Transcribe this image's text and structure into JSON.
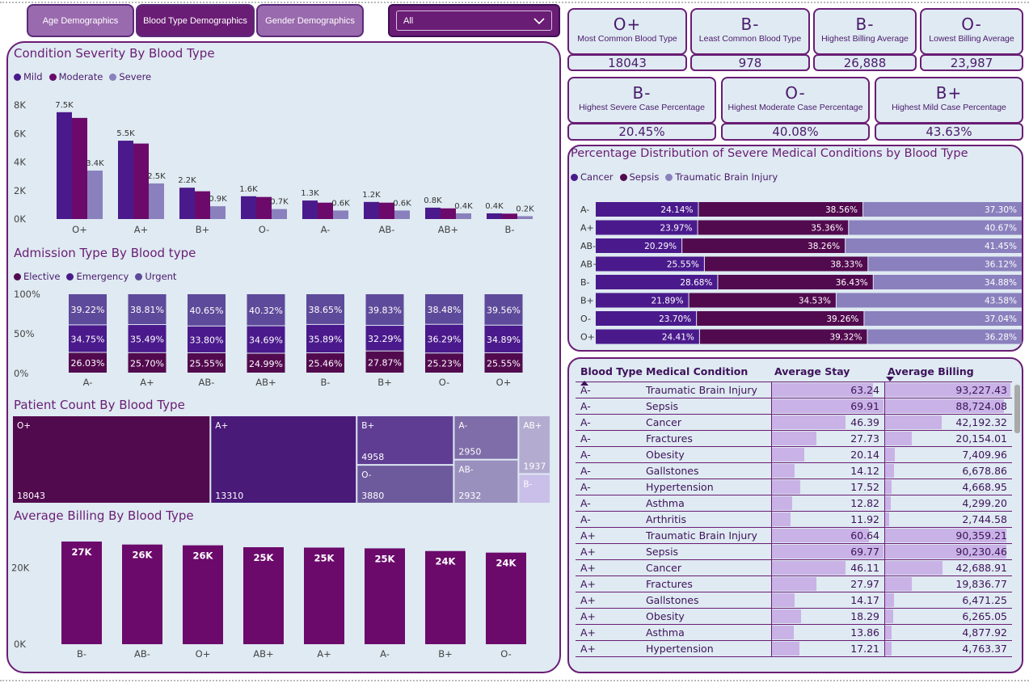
{
  "nav": {
    "tabs": [
      {
        "label": "Age Demographics",
        "active": false
      },
      {
        "label": "Blood Type Demographics",
        "active": true
      },
      {
        "label": "Gender Demographics",
        "active": false
      }
    ],
    "filter_value": "All"
  },
  "kpis": {
    "row1": [
      {
        "value": "O+",
        "label": "Most Common Blood Type",
        "metric": "18043"
      },
      {
        "value": "B-",
        "label": "Least Common Blood Type",
        "metric": "978"
      },
      {
        "value": "B-",
        "label": "Highest Billing Average",
        "metric": "26,888"
      },
      {
        "value": "O-",
        "label": "Lowest Billing Average",
        "metric": "23,987"
      }
    ],
    "row2": [
      {
        "value": "B-",
        "label": "Highest Severe Case Percentage",
        "metric": "20.45%"
      },
      {
        "value": "O-",
        "label": "Highest Moderate Case Percentage",
        "metric": "40.08%"
      },
      {
        "value": "B+",
        "label": "Highest Mild Case Percentage",
        "metric": "43.63%"
      }
    ]
  },
  "colors": {
    "mild": "#4a1a8c",
    "moderate": "#6b0a6b",
    "severe": "#8a80bd",
    "elective": "#520a4f",
    "emergency": "#4a1a8c",
    "urgent": "#5e4a9a",
    "cancer": "#4a1a8c",
    "sepsis": "#520a4f",
    "tbi": "#8a80bd",
    "billing": "#6b0a6b"
  },
  "chart_data": [
    {
      "id": "severity",
      "type": "bar",
      "title": "Condition Severity By Blood Type",
      "categories": [
        "O+",
        "A+",
        "B+",
        "O-",
        "A-",
        "AB-",
        "AB+",
        "B-"
      ],
      "series": [
        {
          "name": "Mild",
          "values": [
            7500,
            5500,
            2200,
            1600,
            1300,
            1200,
            800,
            400
          ],
          "labels": [
            "7.5K",
            "5.5K",
            "2.2K",
            "1.6K",
            "1.3K",
            "1.2K",
            "0.8K",
            "0.4K"
          ]
        },
        {
          "name": "Moderate",
          "values": [
            7100,
            5300,
            1950,
            1550,
            1150,
            1150,
            750,
            380
          ],
          "labels": [
            "",
            "",
            "",
            "",
            "",
            "",
            "",
            ""
          ]
        },
        {
          "name": "Severe",
          "values": [
            3400,
            2500,
            900,
            700,
            600,
            600,
            400,
            200
          ],
          "labels": [
            "3.4K",
            "2.5K",
            "0.9K",
            "0.7K",
            "0.6K",
            "0.6K",
            "0.4K",
            "0.2K"
          ]
        }
      ],
      "yticks": [
        "0K",
        "2K",
        "4K",
        "6K",
        "8K"
      ],
      "ylim": [
        0,
        8000
      ]
    },
    {
      "id": "admission",
      "type": "bar",
      "title": "Admission Type By Blood type",
      "stacked": "percent",
      "categories": [
        "A-",
        "A+",
        "AB-",
        "AB+",
        "B-",
        "B+",
        "O-",
        "O+"
      ],
      "series": [
        {
          "name": "Elective",
          "values": [
            26.03,
            25.7,
            25.55,
            24.99,
            25.46,
            27.87,
            25.23,
            25.55
          ]
        },
        {
          "name": "Emergency",
          "values": [
            34.75,
            35.49,
            33.8,
            34.69,
            35.89,
            32.29,
            36.29,
            34.89
          ]
        },
        {
          "name": "Urgent",
          "values": [
            39.22,
            38.81,
            40.65,
            40.32,
            38.65,
            39.83,
            38.48,
            39.56
          ]
        }
      ],
      "yticks": [
        "0%",
        "50%",
        "100%"
      ]
    },
    {
      "id": "patients",
      "type": "treemap",
      "title": "Patient Count By Blood Type",
      "items": [
        {
          "label": "O+",
          "value": 18043,
          "display": "18043"
        },
        {
          "label": "A+",
          "value": 13310,
          "display": "13310"
        },
        {
          "label": "B+",
          "value": 4958,
          "display": "4958"
        },
        {
          "label": "O-",
          "value": 3880,
          "display": "3880"
        },
        {
          "label": "A-",
          "value": 2950,
          "display": "2950"
        },
        {
          "label": "AB-",
          "value": 2932,
          "display": "2932"
        },
        {
          "label": "AB+",
          "value": 1937,
          "display": "1937"
        },
        {
          "label": "B-",
          "value": 978,
          "display": ""
        }
      ]
    },
    {
      "id": "billing",
      "type": "bar",
      "title": "Average Billing By Blood Type",
      "categories": [
        "B-",
        "AB-",
        "O+",
        "AB+",
        "A+",
        "A-",
        "B+",
        "O-"
      ],
      "values": [
        26888,
        26100,
        25900,
        25400,
        25300,
        25100,
        24400,
        23987
      ],
      "labels": [
        "27K",
        "26K",
        "26K",
        "25K",
        "25K",
        "25K",
        "24K",
        "24K"
      ],
      "yticks": [
        "0K",
        "20K"
      ],
      "ylim": [
        0,
        29000
      ]
    },
    {
      "id": "severe_dist",
      "type": "bar",
      "orientation": "horizontal",
      "stacked": "percent",
      "title": "Percentage Distribution of Severe Medical Conditions by Blood Type",
      "categories": [
        "A-",
        "A+",
        "AB-",
        "AB+",
        "B-",
        "B+",
        "O-",
        "O+"
      ],
      "series": [
        {
          "name": "Cancer",
          "values": [
            24.14,
            23.97,
            20.29,
            25.55,
            28.68,
            21.89,
            23.7,
            24.41
          ]
        },
        {
          "name": "Sepsis",
          "values": [
            38.56,
            35.36,
            38.26,
            38.33,
            36.43,
            34.53,
            39.26,
            39.32
          ]
        },
        {
          "name": "Traumatic Brain Injury",
          "values": [
            37.3,
            40.67,
            41.45,
            36.12,
            34.88,
            43.58,
            37.04,
            36.28
          ]
        }
      ]
    }
  ],
  "table": {
    "headers": [
      "Blood Type",
      "Medical Condition",
      "Average Stay",
      "Average Billing"
    ],
    "stay_max": 70,
    "billing_max": 94000,
    "rows": [
      {
        "bt": "A-",
        "cond": "Traumatic Brain Injury",
        "stay": 63.24,
        "stay_s": "63.24",
        "bill": 93227.43,
        "bill_s": "93,227.43"
      },
      {
        "bt": "A-",
        "cond": "Sepsis",
        "stay": 69.91,
        "stay_s": "69.91",
        "bill": 88724.08,
        "bill_s": "88,724.08"
      },
      {
        "bt": "A-",
        "cond": "Cancer",
        "stay": 46.39,
        "stay_s": "46.39",
        "bill": 42192.32,
        "bill_s": "42,192.32"
      },
      {
        "bt": "A-",
        "cond": "Fractures",
        "stay": 27.73,
        "stay_s": "27.73",
        "bill": 20154.01,
        "bill_s": "20,154.01"
      },
      {
        "bt": "A-",
        "cond": "Obesity",
        "stay": 20.14,
        "stay_s": "20.14",
        "bill": 7409.96,
        "bill_s": "7,409.96"
      },
      {
        "bt": "A-",
        "cond": "Gallstones",
        "stay": 14.12,
        "stay_s": "14.12",
        "bill": 6678.86,
        "bill_s": "6,678.86"
      },
      {
        "bt": "A-",
        "cond": "Hypertension",
        "stay": 17.52,
        "stay_s": "17.52",
        "bill": 4668.95,
        "bill_s": "4,668.95"
      },
      {
        "bt": "A-",
        "cond": "Asthma",
        "stay": 12.82,
        "stay_s": "12.82",
        "bill": 4299.2,
        "bill_s": "4,299.20"
      },
      {
        "bt": "A-",
        "cond": "Arthritis",
        "stay": 11.92,
        "stay_s": "11.92",
        "bill": 2744.58,
        "bill_s": "2,744.58"
      },
      {
        "bt": "A+",
        "cond": "Traumatic Brain Injury",
        "stay": 60.64,
        "stay_s": "60.64",
        "bill": 90359.21,
        "bill_s": "90,359.21"
      },
      {
        "bt": "A+",
        "cond": "Sepsis",
        "stay": 69.77,
        "stay_s": "69.77",
        "bill": 90230.46,
        "bill_s": "90,230.46"
      },
      {
        "bt": "A+",
        "cond": "Cancer",
        "stay": 46.11,
        "stay_s": "46.11",
        "bill": 42688.91,
        "bill_s": "42,688.91"
      },
      {
        "bt": "A+",
        "cond": "Fractures",
        "stay": 27.97,
        "stay_s": "27.97",
        "bill": 19836.77,
        "bill_s": "19,836.77"
      },
      {
        "bt": "A+",
        "cond": "Gallstones",
        "stay": 14.17,
        "stay_s": "14.17",
        "bill": 6471.25,
        "bill_s": "6,471.25"
      },
      {
        "bt": "A+",
        "cond": "Obesity",
        "stay": 18.29,
        "stay_s": "18.29",
        "bill": 6265.05,
        "bill_s": "6,265.05"
      },
      {
        "bt": "A+",
        "cond": "Asthma",
        "stay": 13.86,
        "stay_s": "13.86",
        "bill": 4877.92,
        "bill_s": "4,877.92"
      },
      {
        "bt": "A+",
        "cond": "Hypertension",
        "stay": 17.21,
        "stay_s": "17.21",
        "bill": 4763.37,
        "bill_s": "4,763.37"
      }
    ]
  }
}
